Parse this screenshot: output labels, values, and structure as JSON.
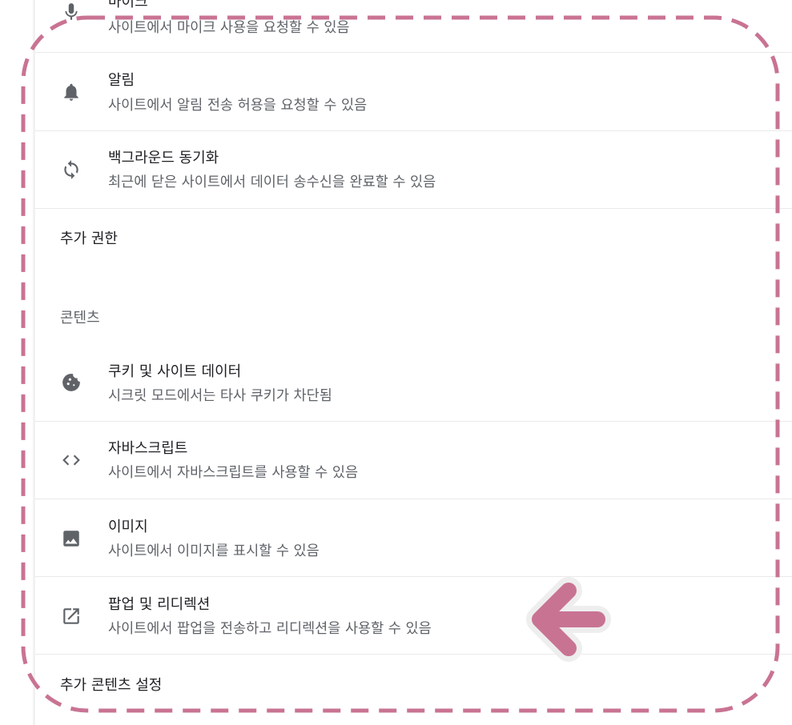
{
  "permissions": {
    "microphone": {
      "title": "마이크",
      "desc": "사이트에서 마이크 사용을 요청할 수 있음",
      "icon": "microphone-icon"
    },
    "notifications": {
      "title": "알림",
      "desc": "사이트에서 알림 전송 허용을 요청할 수 있음",
      "icon": "bell-icon"
    },
    "background_sync": {
      "title": "백그라운드 동기화",
      "desc": "최근에 닫은 사이트에서 데이터 송수신을 완료할 수 있음",
      "icon": "sync-icon"
    },
    "additional_permissions": "추가 권한"
  },
  "content": {
    "heading": "콘텐츠",
    "cookies": {
      "title": "쿠키 및 사이트 데이터",
      "desc": "시크릿 모드에서는 타사 쿠키가 차단됨",
      "icon": "cookie-icon"
    },
    "javascript": {
      "title": "자바스크립트",
      "desc": "사이트에서 자바스크립트를 사용할 수 있음",
      "icon": "code-icon"
    },
    "images": {
      "title": "이미지",
      "desc": "사이트에서 이미지를 표시할 수 있음",
      "icon": "image-icon"
    },
    "popups": {
      "title": "팝업 및 리디렉션",
      "desc": "사이트에서 팝업을 전송하고 리디렉션을 사용할 수 있음",
      "icon": "open-in-new-icon"
    },
    "additional_content": "추가 콘텐츠 설정"
  },
  "annotation": {
    "highlight_color": "#c97393",
    "arrow_color": "#c97393"
  }
}
